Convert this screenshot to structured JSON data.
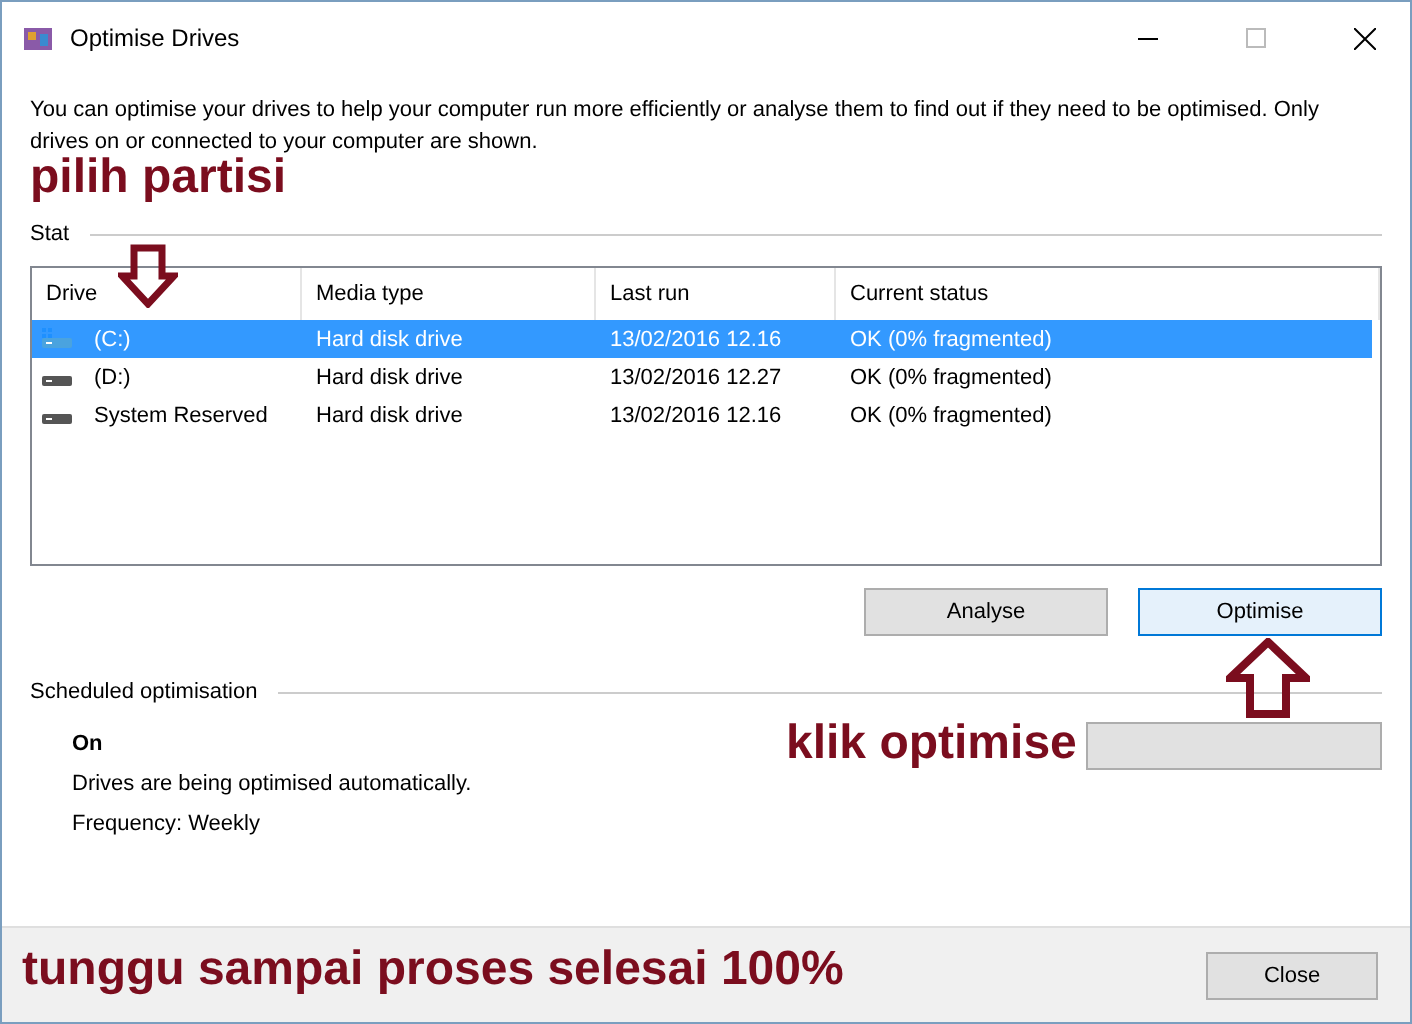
{
  "window": {
    "title": "Optimise Drives"
  },
  "description": "You can optimise your drives to help your computer run more efficiently or analyse them to find out if they need to be optimised. Only drives on or connected to your computer are shown.",
  "status_label": "Stat",
  "table": {
    "columns": [
      "Drive",
      "Media type",
      "Last run",
      "Current status"
    ],
    "rows": [
      {
        "kind": "system",
        "drive": "(C:)",
        "media_type": "Hard disk drive",
        "last_run": "13/02/2016 12.16",
        "status": "OK (0% fragmented)",
        "selected": true
      },
      {
        "kind": "disk",
        "drive": "(D:)",
        "media_type": "Hard disk drive",
        "last_run": "13/02/2016 12.27",
        "status": "OK (0% fragmented)",
        "selected": false
      },
      {
        "kind": "disk",
        "drive": "System Reserved",
        "media_type": "Hard disk drive",
        "last_run": "13/02/2016 12.16",
        "status": "OK (0% fragmented)",
        "selected": false
      }
    ]
  },
  "buttons": [
    {
      "label": "Analyse",
      "focused": false
    },
    {
      "label": "Optimise",
      "focused": true
    }
  ],
  "scheduled": {
    "heading": "Scheduled optimisation",
    "state": "On",
    "description": "Drives are being optimised automatically.",
    "frequency": "Frequency: Weekly"
  },
  "close_button": "Close",
  "annotations": {
    "select": "pilih partisi",
    "click": "klik optimise",
    "wait": "tunggu sampai proses selesai 100%"
  }
}
